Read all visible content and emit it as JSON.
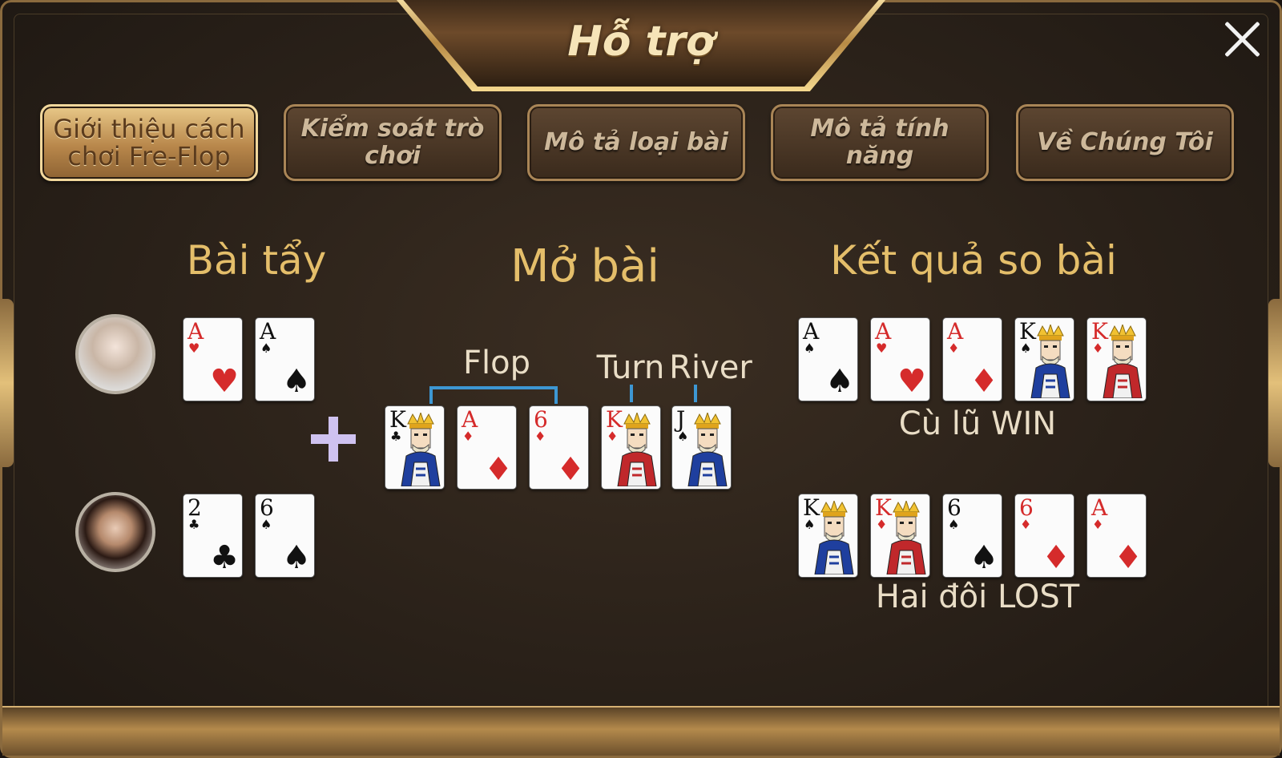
{
  "title": "Hỗ trợ",
  "tabs": [
    {
      "label": "Giới thiệu cách chơi Fre-Flop",
      "active": true
    },
    {
      "label": "Kiểm soát trò chơi",
      "active": false
    },
    {
      "label": "Mô tả loại bài",
      "active": false
    },
    {
      "label": "Mô tả tính năng",
      "active": false
    },
    {
      "label": "Về Chúng Tôi",
      "active": false
    }
  ],
  "sections": {
    "hole": "Bài tẩy",
    "board": "Mở bài",
    "result": "Kết quả so bài"
  },
  "board_labels": {
    "flop": "Flop",
    "turn": "Turn",
    "river": "River"
  },
  "players": [
    {
      "cards": [
        {
          "rank": "A",
          "suit": "♥",
          "color": "red"
        },
        {
          "rank": "A",
          "suit": "♠",
          "color": "black"
        }
      ]
    },
    {
      "cards": [
        {
          "rank": "2",
          "suit": "♣",
          "color": "black"
        },
        {
          "rank": "6",
          "suit": "♠",
          "color": "black"
        }
      ]
    }
  ],
  "board": [
    {
      "rank": "K",
      "suit": "♣",
      "color": "black",
      "face": true
    },
    {
      "rank": "A",
      "suit": "♦",
      "color": "red",
      "face": false
    },
    {
      "rank": "6",
      "suit": "♦",
      "color": "red",
      "face": false
    },
    {
      "rank": "K",
      "suit": "♦",
      "color": "red",
      "face": true
    },
    {
      "rank": "J",
      "suit": "♠",
      "color": "black",
      "face": true
    }
  ],
  "results": [
    {
      "label": "Cù lũ WIN",
      "cards": [
        {
          "rank": "A",
          "suit": "♠",
          "color": "black",
          "face": false
        },
        {
          "rank": "A",
          "suit": "♥",
          "color": "red",
          "face": false
        },
        {
          "rank": "A",
          "suit": "♦",
          "color": "red",
          "face": false
        },
        {
          "rank": "K",
          "suit": "♠",
          "color": "black",
          "face": true
        },
        {
          "rank": "K",
          "suit": "♦",
          "color": "red",
          "face": true
        }
      ]
    },
    {
      "label": "Hai đôi LOST",
      "cards": [
        {
          "rank": "K",
          "suit": "♠",
          "color": "black",
          "face": true
        },
        {
          "rank": "K",
          "suit": "♦",
          "color": "red",
          "face": true
        },
        {
          "rank": "6",
          "suit": "♠",
          "color": "black",
          "face": false
        },
        {
          "rank": "6",
          "suit": "♦",
          "color": "red",
          "face": false
        },
        {
          "rank": "A",
          "suit": "♦",
          "color": "red",
          "face": false
        }
      ]
    }
  ],
  "colors": {
    "gold_text": "#e4be6a",
    "bracket": "#3d97d3",
    "plus": "#cfc2f0"
  }
}
